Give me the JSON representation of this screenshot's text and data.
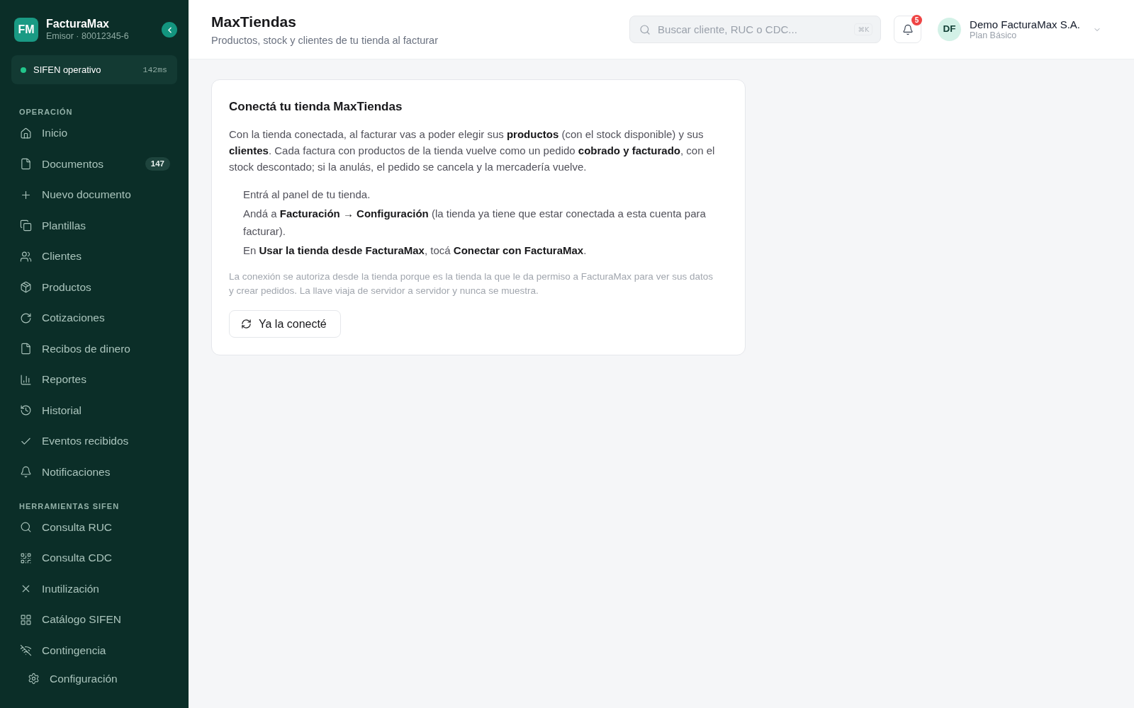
{
  "sidebar": {
    "brand": {
      "logo": "FM",
      "name": "FacturaMax",
      "subtitle": "Emisor · 80012345-6"
    },
    "status": {
      "label": "SIFEN operativo",
      "latency": "142ms",
      "operational": true
    },
    "sections": [
      {
        "title": "OPERACIÓN",
        "items": [
          {
            "label": "Inicio",
            "selected": false
          },
          {
            "label": "Documentos",
            "badge": "147",
            "selected": false
          },
          {
            "label": "Nuevo documento",
            "selected": false
          },
          {
            "label": "Plantillas",
            "selected": false
          },
          {
            "label": "Clientes",
            "selected": false
          },
          {
            "label": "Productos",
            "selected": false
          },
          {
            "label": "Cotizaciones",
            "selected": false
          },
          {
            "label": "Recibos de dinero",
            "selected": false
          },
          {
            "label": "Reportes",
            "selected": false
          },
          {
            "label": "Historial",
            "selected": false
          },
          {
            "label": "Eventos recibidos",
            "selected": false
          },
          {
            "label": "Notificaciones",
            "selected": false
          }
        ]
      },
      {
        "title": "HERRAMIENTAS SIFEN",
        "items": [
          {
            "label": "Consulta RUC",
            "selected": false
          },
          {
            "label": "Consulta CDC",
            "selected": false
          },
          {
            "label": "Inutilización",
            "selected": false
          },
          {
            "label": "Catálogo SIFEN",
            "selected": false
          },
          {
            "label": "Contingencia",
            "selected": false
          }
        ]
      }
    ],
    "settings_item": {
      "label": "Configuración",
      "selected": false
    }
  },
  "header": {
    "title": "MaxTiendas",
    "subtitle": "Productos, stock y clientes de tu tienda al facturar",
    "search": {
      "placeholder": "Buscar cliente, RUC o CDC...",
      "shortcut": "⌘K"
    },
    "notifications": {
      "count": "5"
    },
    "user": {
      "initials": "DF",
      "name": "Demo FacturaMax S.A.",
      "plan": "Plan Básico"
    }
  },
  "card": {
    "title": "Conectá tu tienda MaxTiendas",
    "intro": "Con la tienda conectada, al facturar vas a poder elegir sus **productos** (con el stock disponible) y sus **clientes**. Cada factura con productos de la tienda vuelve como un pedido **cobrado y facturado**, con el stock descontado; si la anulás, el pedido se cancela y la mercadería vuelve.",
    "steps": [
      "Entrá al panel de tu tienda.",
      "Andá a **Facturación → Configuración** (la tienda ya tiene que estar conectada a esta cuenta para facturar).",
      "En **Usar la tienda desde FacturaMax**, tocá **Conectar con FacturaMax**."
    ],
    "note": "La conexión se autoriza desde la tienda porque es la tienda la que le da permiso a FacturaMax para ver sus datos y crear pedidos. La llave viaja de servidor a servidor y nunca se muestra.",
    "button": "Ya la conecté"
  }
}
